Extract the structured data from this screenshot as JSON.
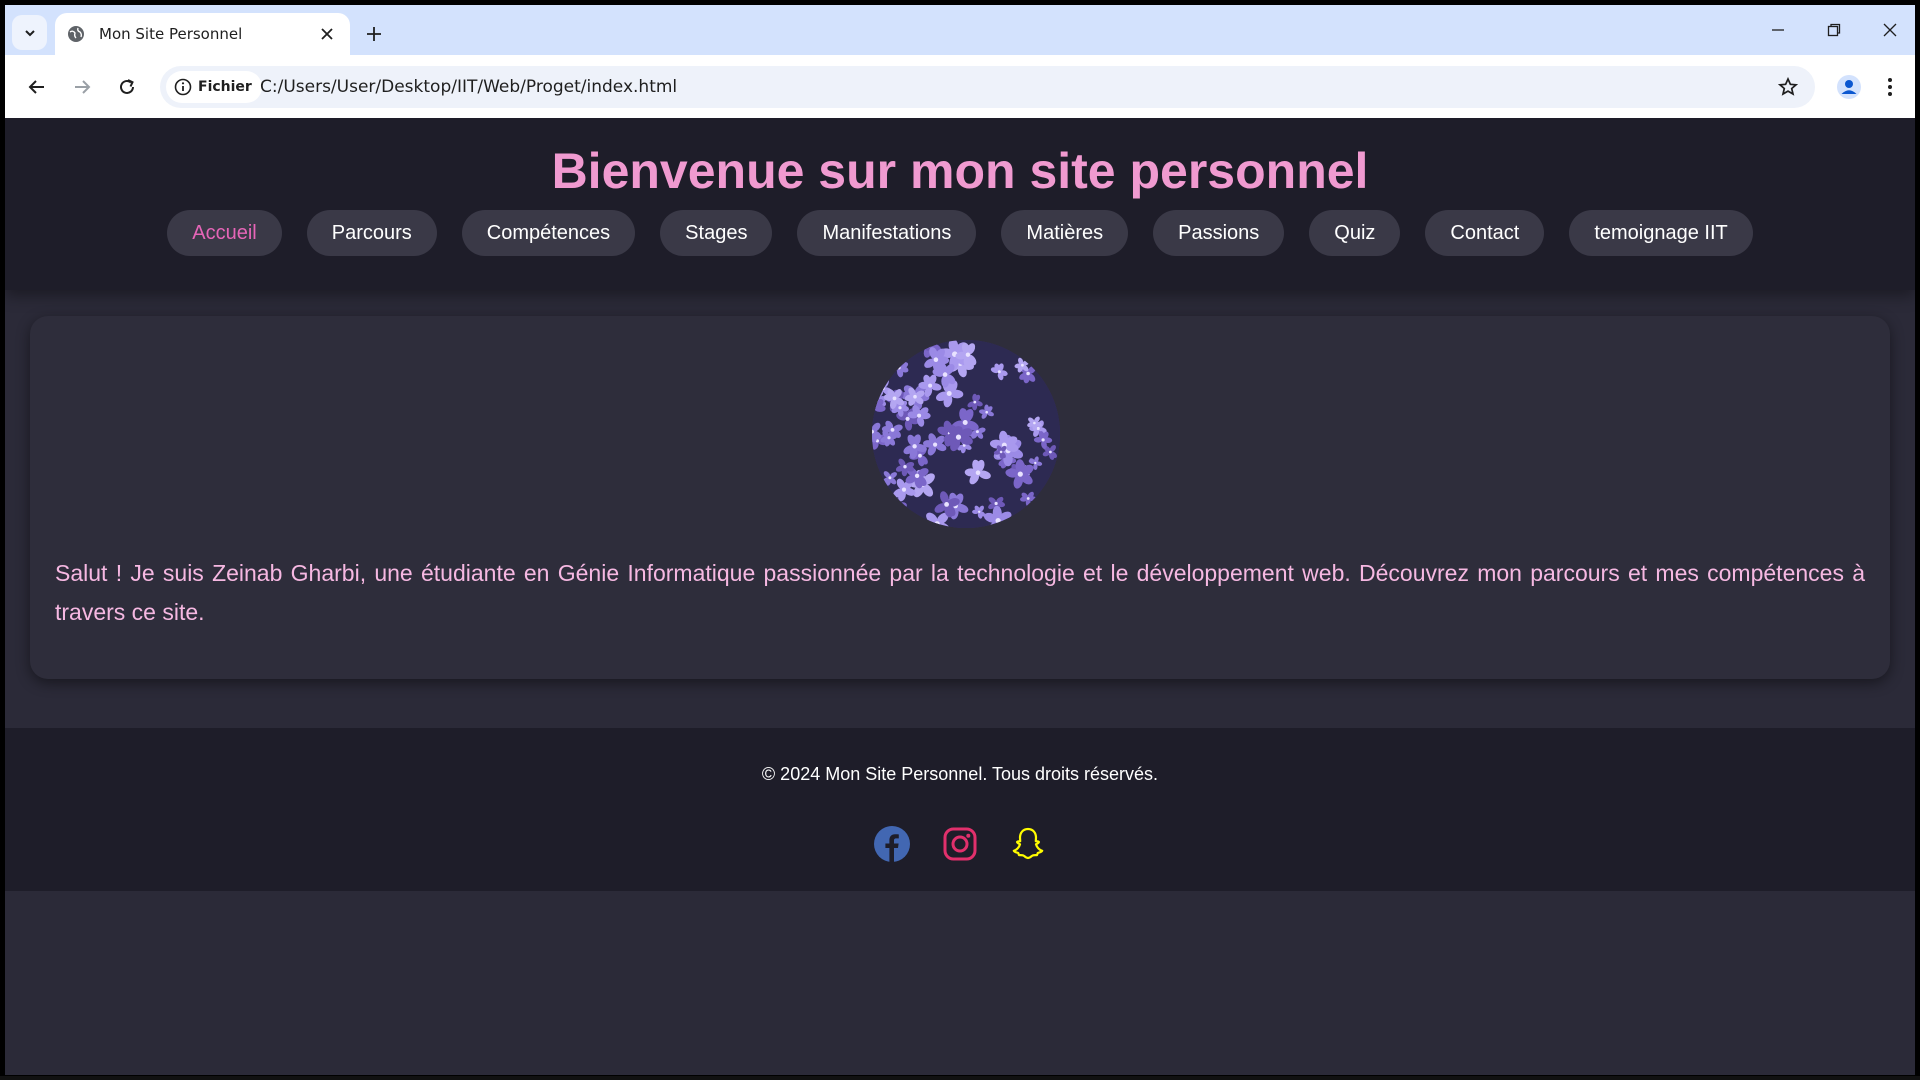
{
  "browser": {
    "tab_title": "Mon Site Personnel",
    "chip_label": "Fichier",
    "url": "C:/Users/User/Desktop/IIT/Web/Proget/index.html"
  },
  "site": {
    "title": "Bienvenue sur mon site personnel",
    "nav": [
      {
        "label": "Accueil",
        "active": true
      },
      {
        "label": "Parcours"
      },
      {
        "label": "Compétences"
      },
      {
        "label": "Stages"
      },
      {
        "label": "Manifestations"
      },
      {
        "label": "Matières"
      },
      {
        "label": "Passions"
      },
      {
        "label": "Quiz"
      },
      {
        "label": "Contact"
      },
      {
        "label": "temoignage IIT"
      }
    ],
    "intro": "Salut ! Je suis Zeinab Gharbi, une étudiante en Génie Informatique passionnée par la technologie et le développement web. Découvrez mon parcours et mes compétences à travers ce site.",
    "footer_text": "© 2024 Mon Site Personnel. Tous droits réservés.",
    "social_icons": [
      "facebook-icon",
      "instagram-icon",
      "snapchat-icon"
    ]
  },
  "colors": {
    "title_pink": "#f09ad0",
    "active_nav": "#e665b8",
    "intro_text": "#f6b8e2",
    "header_bg": "#1e1d29",
    "page_bg": "#2b2a38",
    "facebook": "#4267b2",
    "instagram": "#e1306c",
    "snapchat": "#fffc00"
  }
}
